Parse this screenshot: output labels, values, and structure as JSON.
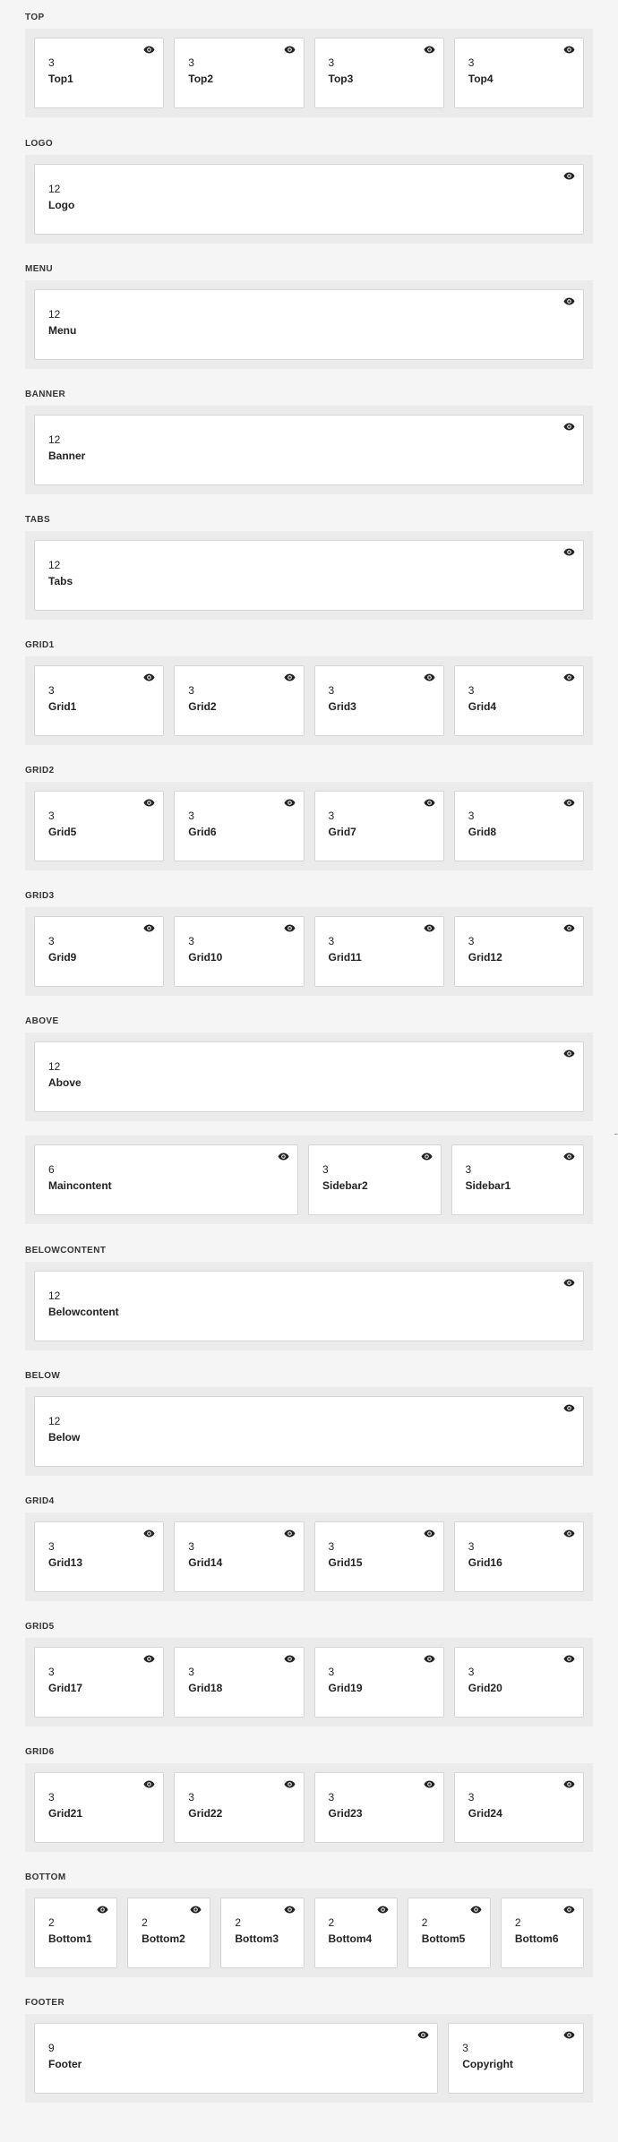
{
  "rows": [
    {
      "title": "TOP",
      "cards": [
        {
          "width": "3",
          "name": "Top1"
        },
        {
          "width": "3",
          "name": "Top2"
        },
        {
          "width": "3",
          "name": "Top3"
        },
        {
          "width": "3",
          "name": "Top4"
        }
      ]
    },
    {
      "title": "LOGO",
      "cards": [
        {
          "width": "12",
          "name": "Logo"
        }
      ]
    },
    {
      "title": "MENU",
      "cards": [
        {
          "width": "12",
          "name": "Menu"
        }
      ]
    },
    {
      "title": "BANNER",
      "cards": [
        {
          "width": "12",
          "name": "Banner"
        }
      ]
    },
    {
      "title": "TABS",
      "cards": [
        {
          "width": "12",
          "name": "Tabs"
        }
      ]
    },
    {
      "title": "GRID1",
      "cards": [
        {
          "width": "3",
          "name": "Grid1"
        },
        {
          "width": "3",
          "name": "Grid2"
        },
        {
          "width": "3",
          "name": "Grid3"
        },
        {
          "width": "3",
          "name": "Grid4"
        }
      ]
    },
    {
      "title": "GRID2",
      "cards": [
        {
          "width": "3",
          "name": "Grid5"
        },
        {
          "width": "3",
          "name": "Grid6"
        },
        {
          "width": "3",
          "name": "Grid7"
        },
        {
          "width": "3",
          "name": "Grid8"
        }
      ]
    },
    {
      "title": "GRID3",
      "cards": [
        {
          "width": "3",
          "name": "Grid9"
        },
        {
          "width": "3",
          "name": "Grid10"
        },
        {
          "width": "3",
          "name": "Grid11"
        },
        {
          "width": "3",
          "name": "Grid12"
        }
      ]
    },
    {
      "title": "ABOVE",
      "cards": [
        {
          "width": "12",
          "name": "Above"
        }
      ]
    },
    {
      "title": "",
      "cards": [
        {
          "width": "6",
          "name": "Maincontent"
        },
        {
          "width": "3",
          "name": "Sidebar2"
        },
        {
          "width": "3",
          "name": "Sidebar1"
        }
      ]
    },
    {
      "title": "BELOWCONTENT",
      "cards": [
        {
          "width": "12",
          "name": "Belowcontent"
        }
      ]
    },
    {
      "title": "BELOW",
      "cards": [
        {
          "width": "12",
          "name": "Below"
        }
      ]
    },
    {
      "title": "GRID4",
      "cards": [
        {
          "width": "3",
          "name": "Grid13"
        },
        {
          "width": "3",
          "name": "Grid14"
        },
        {
          "width": "3",
          "name": "Grid15"
        },
        {
          "width": "3",
          "name": "Grid16"
        }
      ]
    },
    {
      "title": "GRID5",
      "cards": [
        {
          "width": "3",
          "name": "Grid17"
        },
        {
          "width": "3",
          "name": "Grid18"
        },
        {
          "width": "3",
          "name": "Grid19"
        },
        {
          "width": "3",
          "name": "Grid20"
        }
      ]
    },
    {
      "title": "GRID6",
      "cards": [
        {
          "width": "3",
          "name": "Grid21"
        },
        {
          "width": "3",
          "name": "Grid22"
        },
        {
          "width": "3",
          "name": "Grid23"
        },
        {
          "width": "3",
          "name": "Grid24"
        }
      ]
    },
    {
      "title": "BOTTOM",
      "cards": [
        {
          "width": "2",
          "name": "Bottom1"
        },
        {
          "width": "2",
          "name": "Bottom2"
        },
        {
          "width": "2",
          "name": "Bottom3"
        },
        {
          "width": "2",
          "name": "Bottom4"
        },
        {
          "width": "2",
          "name": "Bottom5"
        },
        {
          "width": "2",
          "name": "Bottom6"
        }
      ]
    },
    {
      "title": "FOOTER",
      "cards": [
        {
          "width": "9",
          "name": "Footer"
        },
        {
          "width": "3",
          "name": "Copyright"
        }
      ]
    }
  ],
  "icons": {
    "visibility": "eye-icon"
  },
  "colors": {
    "page_bg": "#f5f5f5",
    "row_bg": "#ebebeb",
    "card_bg": "#ffffff",
    "card_border": "#d5d5d5",
    "text": "#222222"
  }
}
